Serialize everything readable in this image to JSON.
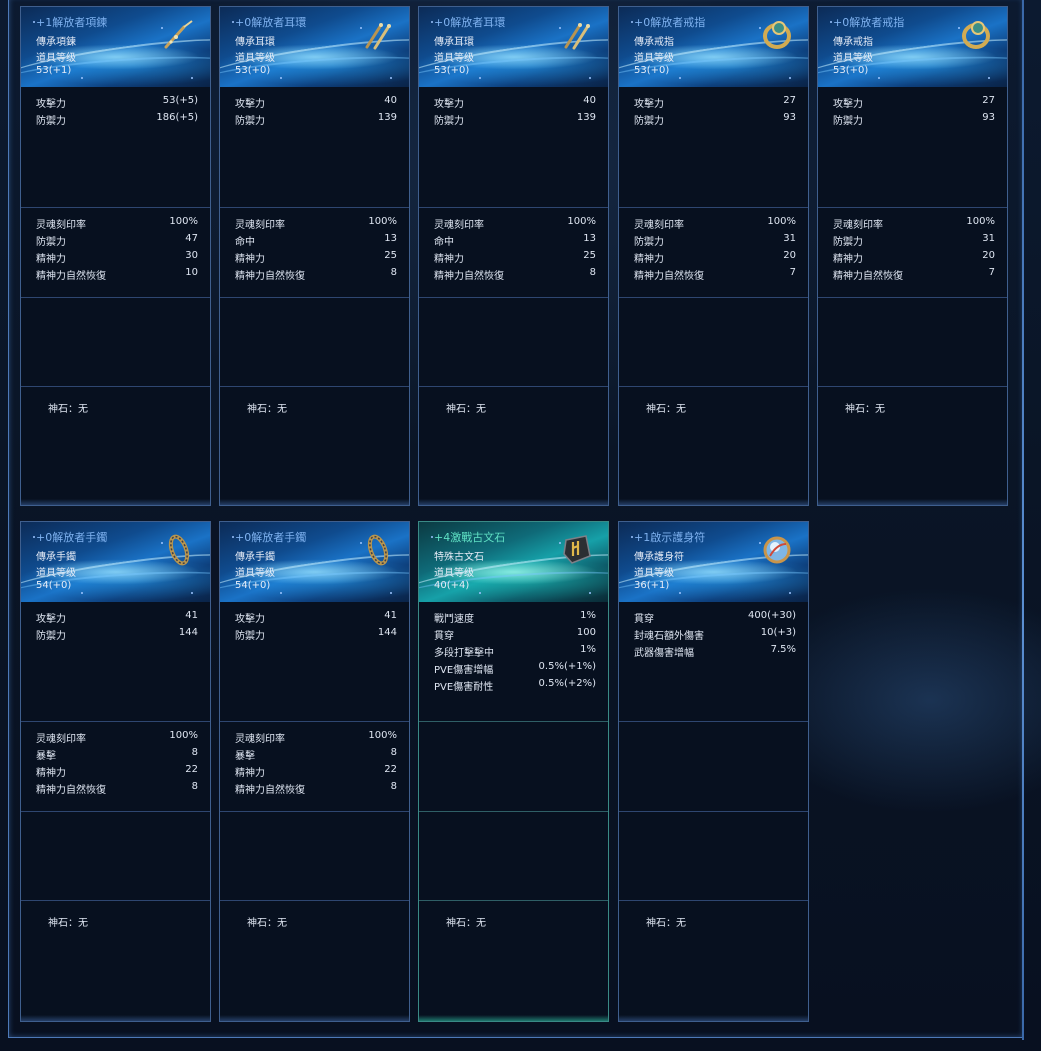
{
  "godstone_label": "神石：",
  "godstone_none": "无",
  "row1": [
    {
      "name": "+1解放者項鍊",
      "type": "傳承項鍊",
      "level_label": "道具等级",
      "level": "53(+1)",
      "icon": "necklace-icon",
      "base": [
        {
          "n": "攻擊力",
          "v": "53(+5)"
        },
        {
          "n": "防禦力",
          "v": "186(+5)"
        }
      ],
      "extra": [
        {
          "n": "灵魂刻印率",
          "v": "100%"
        },
        {
          "n": "防禦力",
          "v": "47"
        },
        {
          "n": "精神力",
          "v": "30"
        },
        {
          "n": "精神力自然恢復",
          "v": "10"
        }
      ]
    },
    {
      "name": "+0解放者耳環",
      "type": "傳承耳環",
      "level_label": "道具等级",
      "level": "53(+0)",
      "icon": "earring-icon",
      "base": [
        {
          "n": "攻擊力",
          "v": "40"
        },
        {
          "n": "防禦力",
          "v": "139"
        }
      ],
      "extra": [
        {
          "n": "灵魂刻印率",
          "v": "100%"
        },
        {
          "n": "命中",
          "v": "13"
        },
        {
          "n": "精神力",
          "v": "25"
        },
        {
          "n": "精神力自然恢復",
          "v": "8"
        }
      ]
    },
    {
      "name": "+0解放者耳環",
      "type": "傳承耳環",
      "level_label": "道具等级",
      "level": "53(+0)",
      "icon": "earring-icon",
      "base": [
        {
          "n": "攻擊力",
          "v": "40"
        },
        {
          "n": "防禦力",
          "v": "139"
        }
      ],
      "extra": [
        {
          "n": "灵魂刻印率",
          "v": "100%"
        },
        {
          "n": "命中",
          "v": "13"
        },
        {
          "n": "精神力",
          "v": "25"
        },
        {
          "n": "精神力自然恢復",
          "v": "8"
        }
      ]
    },
    {
      "name": "+0解放者戒指",
      "type": "傳承戒指",
      "level_label": "道具等级",
      "level": "53(+0)",
      "icon": "ring-icon",
      "base": [
        {
          "n": "攻擊力",
          "v": "27"
        },
        {
          "n": "防禦力",
          "v": "93"
        }
      ],
      "extra": [
        {
          "n": "灵魂刻印率",
          "v": "100%"
        },
        {
          "n": "防禦力",
          "v": "31"
        },
        {
          "n": "精神力",
          "v": "20"
        },
        {
          "n": "精神力自然恢復",
          "v": "7"
        }
      ]
    },
    {
      "name": "+0解放者戒指",
      "type": "傳承戒指",
      "level_label": "道具等级",
      "level": "53(+0)",
      "icon": "ring-icon",
      "base": [
        {
          "n": "攻擊力",
          "v": "27"
        },
        {
          "n": "防禦力",
          "v": "93"
        }
      ],
      "extra": [
        {
          "n": "灵魂刻印率",
          "v": "100%"
        },
        {
          "n": "防禦力",
          "v": "31"
        },
        {
          "n": "精神力",
          "v": "20"
        },
        {
          "n": "精神力自然恢復",
          "v": "7"
        }
      ]
    }
  ],
  "row2": [
    {
      "name": "+0解放者手鐲",
      "type": "傳承手鐲",
      "level_label": "道具等级",
      "level": "54(+0)",
      "icon": "bracelet-icon",
      "base": [
        {
          "n": "攻擊力",
          "v": "41"
        },
        {
          "n": "防禦力",
          "v": "144"
        }
      ],
      "extra": [
        {
          "n": "灵魂刻印率",
          "v": "100%"
        },
        {
          "n": "暴擊",
          "v": "8"
        },
        {
          "n": "精神力",
          "v": "22"
        },
        {
          "n": "精神力自然恢復",
          "v": "8"
        }
      ]
    },
    {
      "name": "+0解放者手鐲",
      "type": "傳承手鐲",
      "level_label": "道具等级",
      "level": "54(+0)",
      "icon": "bracelet-icon",
      "base": [
        {
          "n": "攻擊力",
          "v": "41"
        },
        {
          "n": "防禦力",
          "v": "144"
        }
      ],
      "extra": [
        {
          "n": "灵魂刻印率",
          "v": "100%"
        },
        {
          "n": "暴擊",
          "v": "8"
        },
        {
          "n": "精神力",
          "v": "22"
        },
        {
          "n": "精神力自然恢復",
          "v": "8"
        }
      ]
    },
    {
      "name": "+4激戰古文石",
      "type": "特殊古文石",
      "level_label": "道具等级",
      "level": "40(+4)",
      "icon": "rune-stone-icon",
      "base": [
        {
          "n": "戰鬥速度",
          "v": "1%"
        },
        {
          "n": "貫穿",
          "v": "100"
        },
        {
          "n": "多段打擊擊中",
          "v": "1%"
        },
        {
          "n": "PVE傷害增幅",
          "v": "0.5%(+1%)"
        },
        {
          "n": "PVE傷害耐性",
          "v": "0.5%(+2%)"
        }
      ],
      "extra": []
    },
    {
      "name": "+1啟示護身符",
      "type": "傳承護身符",
      "level_label": "道具等级",
      "level": "36(+1)",
      "icon": "amulet-icon",
      "base": [
        {
          "n": "貫穿",
          "v": "400(+30)"
        },
        {
          "n": "封魂石額外傷害",
          "v": "10(+3)"
        },
        {
          "n": "武器傷害增幅",
          "v": "7.5%"
        }
      ],
      "extra": []
    }
  ]
}
